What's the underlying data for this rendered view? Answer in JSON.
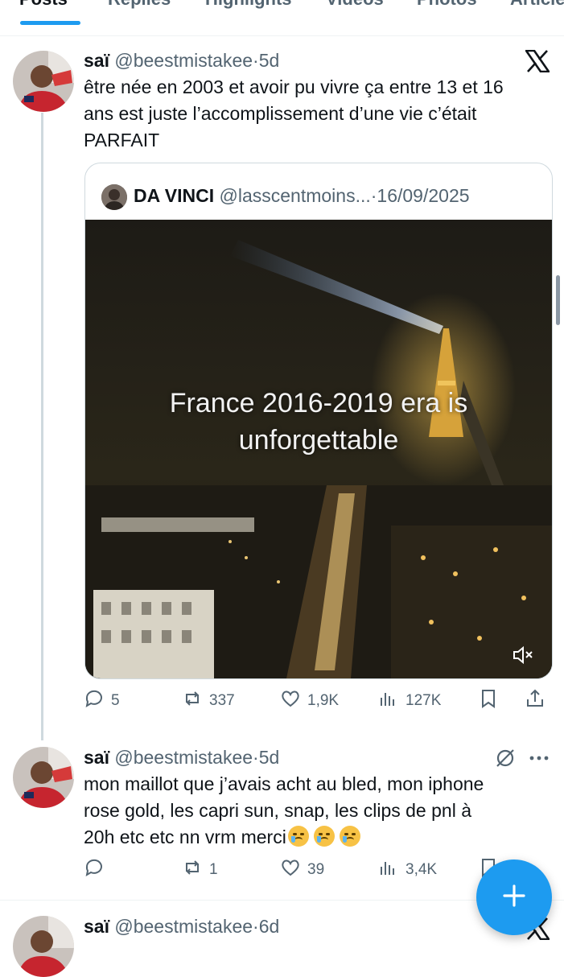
{
  "tabs": [
    "Posts",
    "Replies",
    "Highlights",
    "Videos",
    "Photos",
    "Articles"
  ],
  "tweet1": {
    "name": "saï",
    "handle": "@beestmistakee",
    "time": "5d",
    "text_lines": [
      "être née en 2003 et avoir pu vivre ça entre 13 et 16",
      "ans est juste l’accomplissement d’une vie c’était",
      "PARFAIT"
    ],
    "quote": {
      "name": "DA VINCI",
      "handle": "@lasscentmoins...",
      "date": "16/09/2025",
      "video_caption_lines": [
        "France 2016-2019 era is",
        "unforgettable"
      ]
    },
    "stats": {
      "replies": "5",
      "reposts": "337",
      "likes": "1,9K",
      "views": "127K"
    }
  },
  "tweet2": {
    "name": "saï",
    "handle": "@beestmistakee",
    "time": "5d",
    "text_lines": [
      "mon maillot que j’avais acht au bled, mon iphone",
      "rose gold, les capri sun, snap, les clips de pnl à",
      "20h etc etc nn vrm merci"
    ],
    "emoji": "crying-face",
    "stats": {
      "replies": "",
      "reposts": "1",
      "likes": "39",
      "views": "3,4K"
    }
  },
  "tweet3": {
    "name": "saï",
    "handle": "@beestmistakee",
    "time": "6d"
  },
  "colors": {
    "accent": "#1d9bf0",
    "secondary_text": "#536471",
    "border": "#cfd9de"
  }
}
